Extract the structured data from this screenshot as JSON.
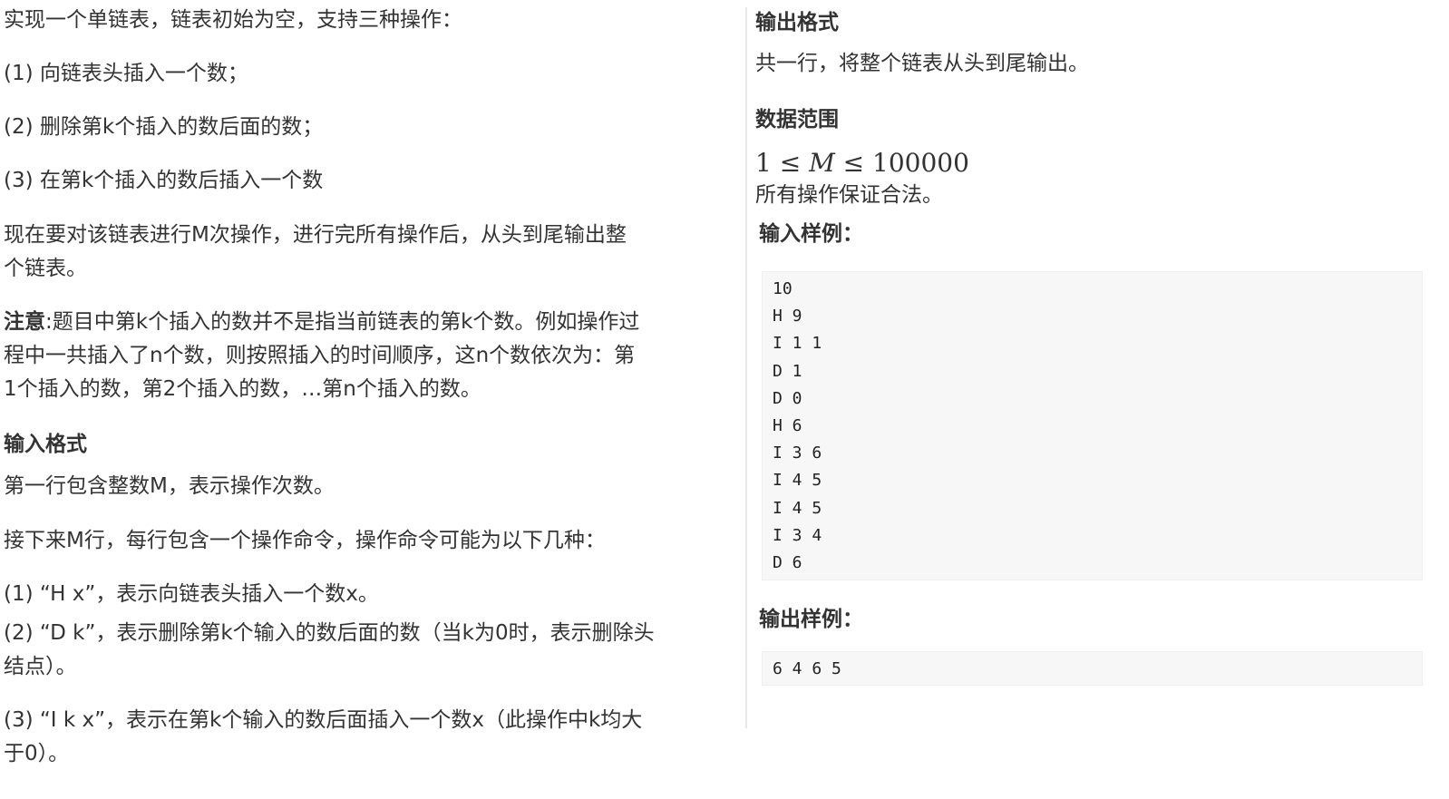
{
  "left": {
    "intro": "实现一个单链表，链表初始为空，支持三种操作：",
    "op1": "(1) 向链表头插入一个数；",
    "op2": "(2) 删除第k个插入的数后面的数；",
    "op3": "(3) 在第k个插入的数后插入一个数",
    "para_m_line1": "现在要对该链表进行M次操作，进行完所有操作后，从头到尾输出整",
    "para_m_line2": "个链表。",
    "note_label": "注意",
    "note_line1_rest": ":题目中第k个插入的数并不是指当前链表的第k个数。例如操作过",
    "note_line2": "程中一共插入了n个数，则按照插入的时间顺序，这n个数依次为：第",
    "note_line3": "1个插入的数，第2个插入的数，…第n个插入的数。",
    "input_format_heading": "输入格式",
    "input_line1": "第一行包含整数M，表示操作次数。",
    "input_line2": "接下来M行，每行包含一个操作命令，操作命令可能为以下几种：",
    "cmd1": "(1) “H x”，表示向链表头插入一个数x。",
    "cmd2_line1": "(2) “D k”，表示删除第k个输入的数后面的数（当k为0时，表示删除头",
    "cmd2_line2": "结点）。",
    "cmd3_line1": "(3) “I k x”，表示在第k个输入的数后面插入一个数x（此操作中k均大",
    "cmd3_line2": "于0）。"
  },
  "right": {
    "output_format_heading": "输出格式",
    "output_format_text": "共一行，将整个链表从头到尾输出。",
    "range_heading": "数据范围",
    "range_math_num": "1 ≤ ",
    "range_math_var": "M",
    "range_math_rest": " ≤ 100000",
    "range_note": "所有操作保证合法。",
    "sample_input_heading": "输入样例：",
    "sample_input_lines": [
      "10",
      "H 9",
      "I 1 1",
      "D 1",
      "D 0",
      "H 6",
      "I 3 6",
      "I 4 5",
      "I 4 5",
      "I 3 4",
      "D 6"
    ],
    "sample_output_heading": "输出样例：",
    "sample_output_text": "6 4 6 5"
  }
}
